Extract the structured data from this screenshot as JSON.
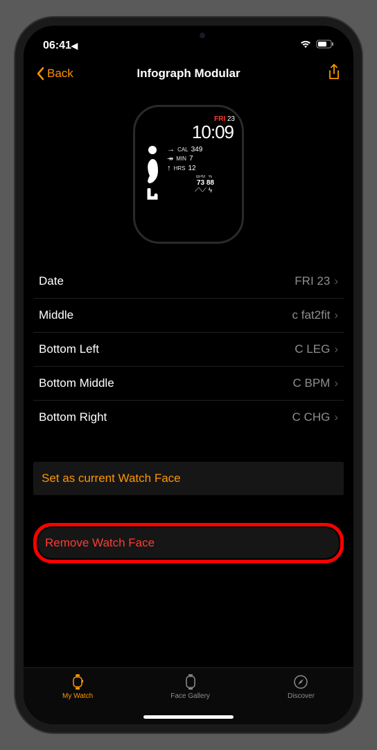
{
  "status": {
    "time": "06:41",
    "loc_icon": "◤"
  },
  "header": {
    "back": "Back",
    "title": "Infograph Modular"
  },
  "preview": {
    "fri": "FRI",
    "daynum": "23",
    "time": "10:09",
    "stat1_label": "CAL",
    "stat1_val": "349",
    "stat2_label": "MIN",
    "stat2_val": "7",
    "stat3_label": "HRS",
    "stat3_val": "12",
    "bpm_label": "BPM",
    "bpm_val": "73",
    "chg_label": "%",
    "chg_val": "88"
  },
  "rows": [
    {
      "label": "Date",
      "value": "FRI 23"
    },
    {
      "label": "Middle",
      "value": "c fat2fit"
    },
    {
      "label": "Bottom Left",
      "value": "C LEG"
    },
    {
      "label": "Bottom Middle",
      "value": "C BPM"
    },
    {
      "label": "Bottom Right",
      "value": "C CHG"
    }
  ],
  "actions": {
    "set_current": "Set as current Watch Face",
    "remove": "Remove Watch Face"
  },
  "tabs": {
    "mywatch": "My Watch",
    "gallery": "Face Gallery",
    "discover": "Discover"
  }
}
